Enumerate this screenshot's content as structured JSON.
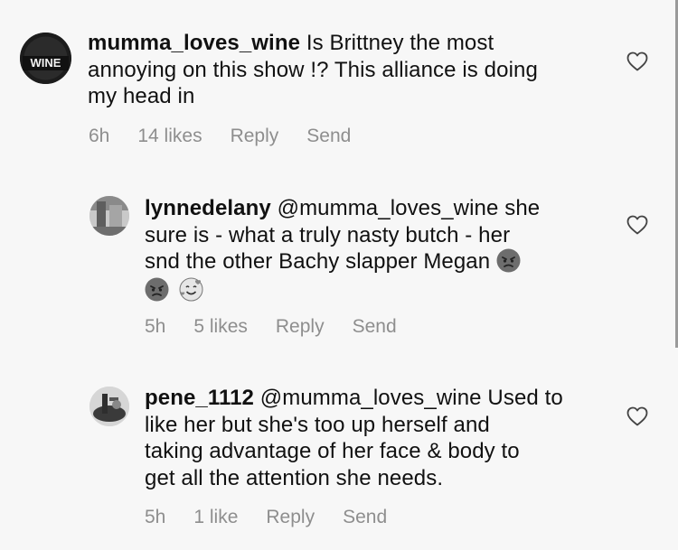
{
  "comments": [
    {
      "username": "mumma_loves_wine",
      "text": "Is Brittney the most annoying on this show !? This alliance is doing my head in",
      "line1": "Is Brittney the most",
      "line2": "annoying on this show !? This alliance is doing",
      "line3": "my head in",
      "avatar_text": "WINE",
      "time": "6h",
      "likes": "14 likes",
      "reply": "Reply",
      "send": "Send"
    },
    {
      "username": "lynnedelany",
      "mention": "@mumma_loves_wine",
      "line1": "she",
      "line2": "sure is - what a truly nasty butch - her",
      "line3": "snd the other Bachy slapper Megan",
      "time": "5h",
      "likes": "5 likes",
      "reply": "Reply",
      "send": "Send"
    },
    {
      "username": "pene_1112",
      "mention": "@mumma_loves_wine",
      "line1": "Used to",
      "line2": "like her but she's too up herself and",
      "line3": "taking advantage of her face & body to",
      "line4": "get all the attention she needs.",
      "time": "5h",
      "likes": "1 like",
      "reply": "Reply",
      "send": "Send"
    }
  ],
  "icons": {
    "like": "heart-outline-icon",
    "emoji_angry": "angry-face-emoji",
    "emoji_loving": "smiling-face-with-hearts-emoji"
  },
  "colors": {
    "background": "#f7f7f7",
    "meta_text": "#8e8e8e",
    "text": "#111111"
  }
}
